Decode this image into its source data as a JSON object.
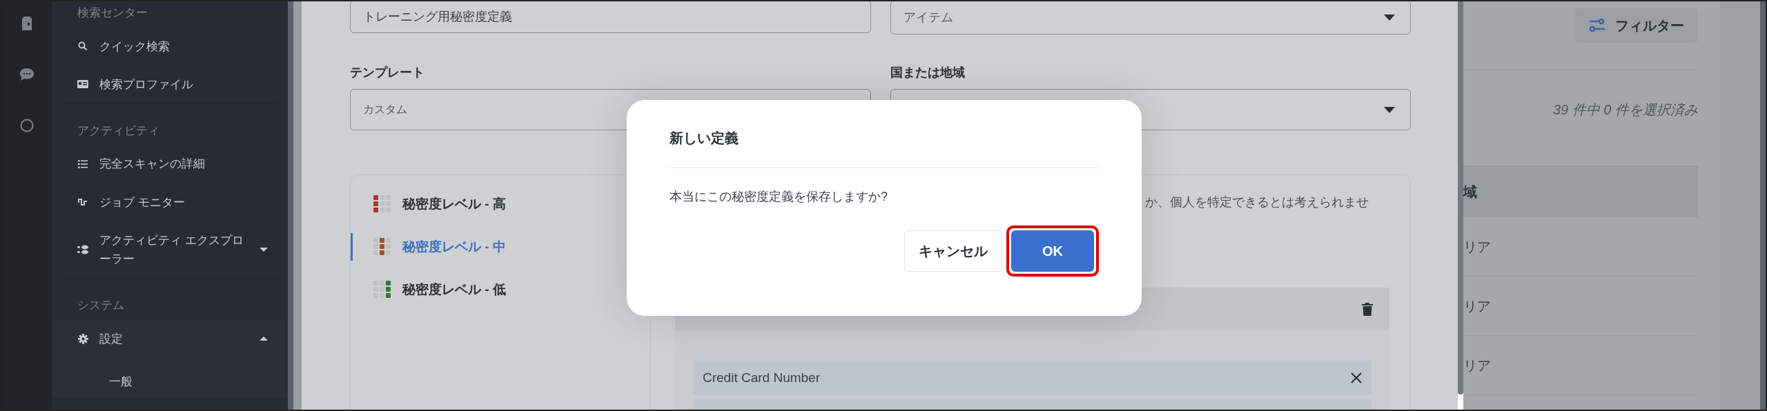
{
  "sidebar": {
    "sections": [
      {
        "title": "検索センター",
        "items": [
          {
            "label": "クイック検索"
          },
          {
            "label": "検索プロファイル"
          }
        ]
      },
      {
        "title": "アクティビティ",
        "items": [
          {
            "label": "完全スキャンの詳細"
          },
          {
            "label": "ジョブ モニター"
          },
          {
            "label": "アクティビティ エクスプローラー",
            "expanded": false
          }
        ]
      },
      {
        "title": "システム",
        "items": [
          {
            "label": "設定",
            "expanded": true,
            "children": [
              {
                "label": "一般"
              }
            ]
          }
        ]
      }
    ]
  },
  "form": {
    "name_field": {
      "value": "トレーニング用秘密度定義"
    },
    "type_select": {
      "value": "アイテム"
    },
    "template": {
      "label": "テンプレート",
      "value": "カスタム",
      "disabled": true
    },
    "region": {
      "label": "国または地域"
    }
  },
  "levels": [
    {
      "label": "秘密度レベル - 高",
      "selected": false,
      "color": "#b03131"
    },
    {
      "label": "秘密度レベル - 中",
      "selected": true,
      "color": "#a0522d"
    },
    {
      "label": "秘密度レベル - 低",
      "selected": false,
      "color": "#2e7d3a"
    }
  ],
  "description": "か、個人を特定できるとは考えられませ",
  "condition": {
    "rows": [
      {
        "label": "Credit Card Number"
      }
    ]
  },
  "dialog": {
    "title": "新しい定義",
    "message": "本当にこの秘密度定義を保存しますか?",
    "buttons": [
      {
        "label": "キャンセル",
        "kind": "secondary",
        "highlighted": false
      },
      {
        "label": "OK",
        "kind": "primary",
        "highlighted": true
      }
    ]
  },
  "background": {
    "filter_button": "フィルター",
    "selection_count": "39 件中 0 件を選択済み",
    "column_header": "域",
    "rows": [
      "リア",
      "リア",
      "リア"
    ]
  }
}
